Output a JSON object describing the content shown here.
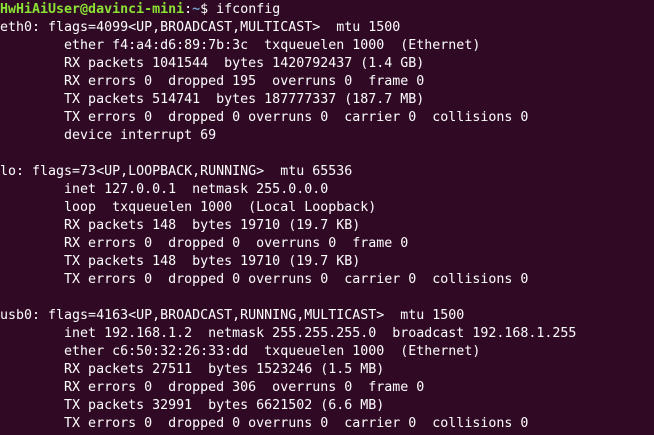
{
  "terminal": {
    "prompt": {
      "user_host": "HwHiAiUser@davinci-mini",
      "separator": ":",
      "path": "~",
      "symbol": "$ ",
      "command": "ifconfig"
    },
    "lines": [
      "eth0: flags=4099<UP,BROADCAST,MULTICAST>  mtu 1500",
      "        ether f4:a4:d6:89:7b:3c  txqueuelen 1000  (Ethernet)",
      "        RX packets 1041544  bytes 1420792437 (1.4 GB)",
      "        RX errors 0  dropped 195  overruns 0  frame 0",
      "        TX packets 514741  bytes 187777337 (187.7 MB)",
      "        TX errors 0  dropped 0 overruns 0  carrier 0  collisions 0",
      "        device interrupt 69",
      "",
      "lo: flags=73<UP,LOOPBACK,RUNNING>  mtu 65536",
      "        inet 127.0.0.1  netmask 255.0.0.0",
      "        loop  txqueuelen 1000  (Local Loopback)",
      "        RX packets 148  bytes 19710 (19.7 KB)",
      "        RX errors 0  dropped 0  overruns 0  frame 0",
      "        TX packets 148  bytes 19710 (19.7 KB)",
      "        TX errors 0  dropped 0 overruns 0  carrier 0  collisions 0",
      "",
      "usb0: flags=4163<UP,BROADCAST,RUNNING,MULTICAST>  mtu 1500",
      "        inet 192.168.1.2  netmask 255.255.255.0  broadcast 192.168.1.255",
      "        ether c6:50:32:26:33:dd  txqueuelen 1000  (Ethernet)",
      "        RX packets 27511  bytes 1523246 (1.5 MB)",
      "        RX errors 0  dropped 306  overruns 0  frame 0",
      "        TX packets 32991  bytes 6621502 (6.6 MB)",
      "        TX errors 0  dropped 0 overruns 0  carrier 0  collisions 0"
    ]
  }
}
